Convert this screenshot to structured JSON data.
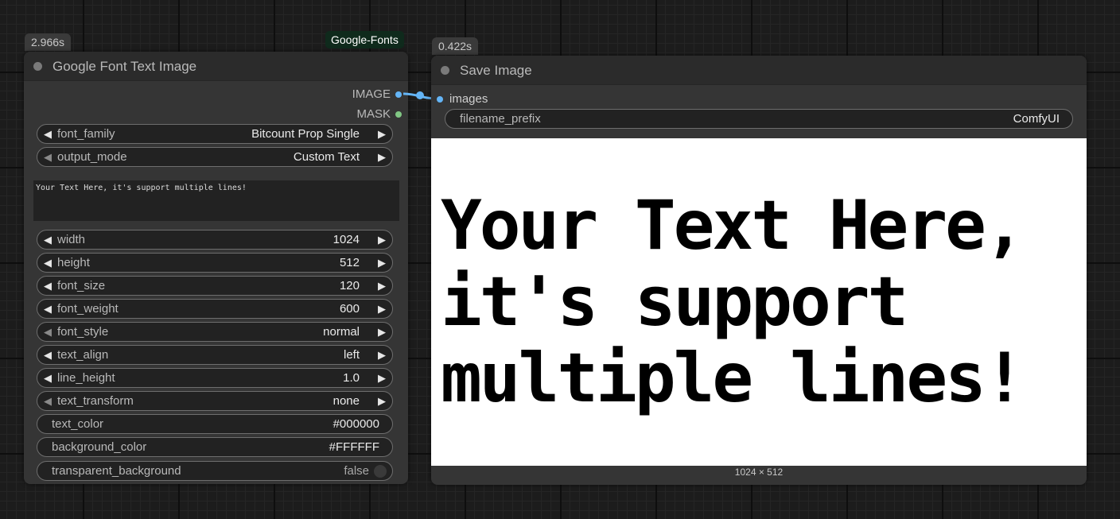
{
  "node1": {
    "time": "2.966s",
    "group_badge": "Google-Fonts",
    "title": "Google Font Text Image",
    "outputs": [
      {
        "label": "IMAGE",
        "color": "#64b5f6"
      },
      {
        "label": "MASK",
        "color": "#81c784"
      }
    ],
    "text": "Your Text Here, it's support multiple lines!",
    "widgets_top": [
      {
        "label": "font_family",
        "value": "Bitcount Prop Single"
      },
      {
        "label": "output_mode",
        "value": "Custom Text"
      }
    ],
    "widgets": [
      {
        "label": "width",
        "value": "1024"
      },
      {
        "label": "height",
        "value": "512"
      },
      {
        "label": "font_size",
        "value": "120"
      },
      {
        "label": "font_weight",
        "value": "600"
      },
      {
        "label": "font_style",
        "value": "normal"
      },
      {
        "label": "text_align",
        "value": "left"
      },
      {
        "label": "line_height",
        "value": "1.0"
      },
      {
        "label": "text_transform",
        "value": "none"
      }
    ],
    "plain_widgets": [
      {
        "label": "text_color",
        "value": "#000000"
      },
      {
        "label": "background_color",
        "value": "#FFFFFF"
      }
    ],
    "toggle": {
      "label": "transparent_background",
      "value": "false"
    }
  },
  "node2": {
    "time": "0.422s",
    "title": "Save Image",
    "input": {
      "label": "images",
      "color": "#64b5f6"
    },
    "filename_prefix": {
      "label": "filename_prefix",
      "value": "ComfyUI"
    },
    "preview_text": "Your Text Here,\nit's support\nmultiple lines!",
    "dimensions": "1024 × 512"
  },
  "link_color": "#64b5f6"
}
